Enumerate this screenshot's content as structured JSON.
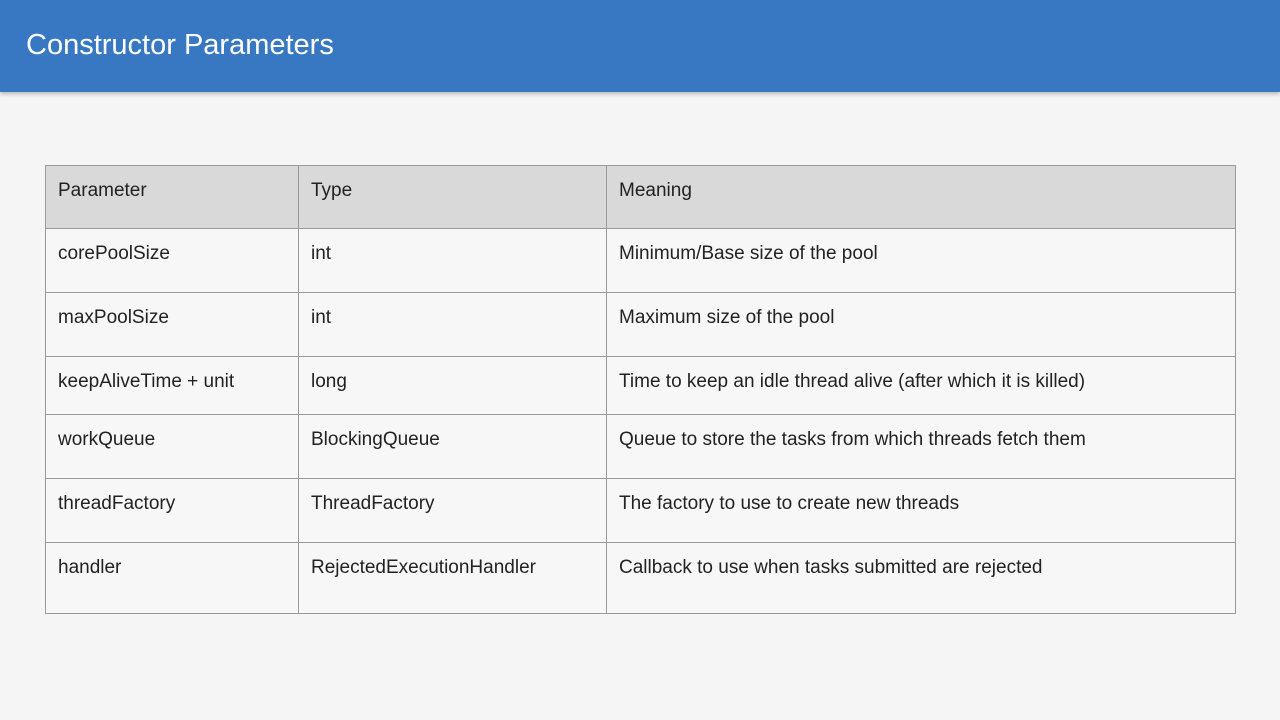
{
  "slide": {
    "title": "Constructor Parameters"
  },
  "table": {
    "headers": [
      "Parameter",
      "Type",
      "Meaning"
    ],
    "rows": [
      [
        "corePoolSize",
        "int",
        "Minimum/Base size of the pool"
      ],
      [
        "maxPoolSize",
        "int",
        "Maximum size of the pool"
      ],
      [
        "keepAliveTime + unit",
        "long",
        "Time to keep an idle thread alive (after which it is killed)"
      ],
      [
        "workQueue",
        "BlockingQueue",
        "Queue to store the tasks from which threads fetch them"
      ],
      [
        "threadFactory",
        "ThreadFactory",
        "The factory to use to create new threads"
      ],
      [
        "handler",
        "RejectedExecutionHandler",
        "Callback to use when tasks submitted are rejected"
      ]
    ]
  },
  "colors": {
    "header_bg": "#3878c2",
    "table_header_bg": "#d9d9d9",
    "border": "#9a9a9a"
  }
}
